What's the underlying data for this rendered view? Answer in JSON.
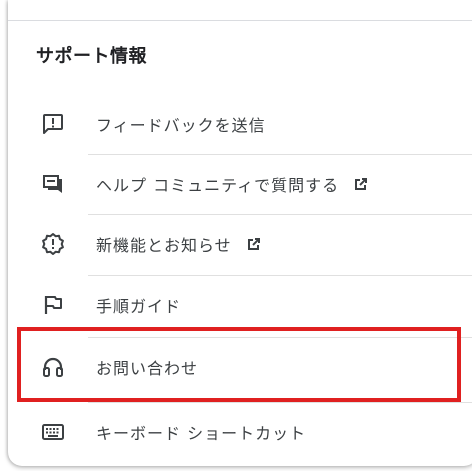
{
  "support": {
    "title": "サポート情報",
    "items": [
      {
        "label": "フィードバックを送信",
        "icon": "feedback-icon",
        "external": false
      },
      {
        "label": "ヘルプ コミュニティで質問する",
        "icon": "forum-icon",
        "external": true
      },
      {
        "label": "新機能とお知らせ",
        "icon": "new-releases-icon",
        "external": true
      },
      {
        "label": "手順ガイド",
        "icon": "flag-icon",
        "external": false
      },
      {
        "label": "お問い合わせ",
        "icon": "headset-icon",
        "external": false
      },
      {
        "label": "キーボード ショートカット",
        "icon": "keyboard-icon",
        "external": false
      }
    ]
  },
  "colors": {
    "icon": "#3c4043",
    "highlight": "#e02020"
  }
}
